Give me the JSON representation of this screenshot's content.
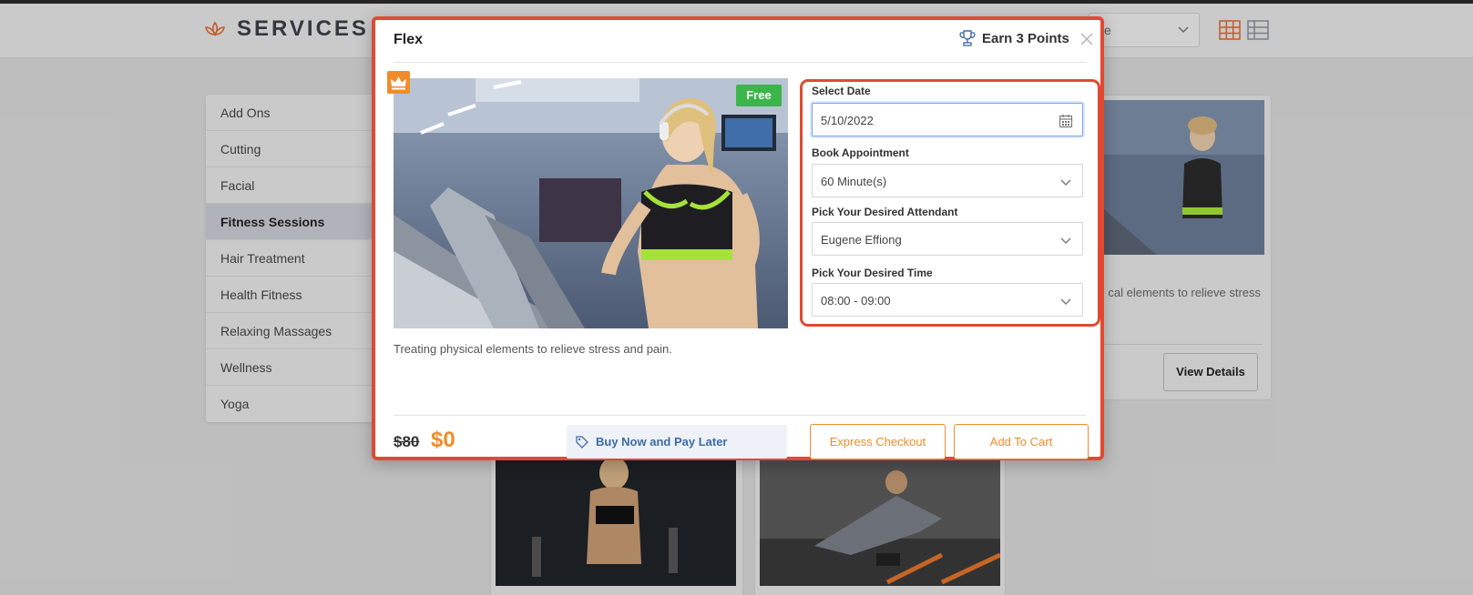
{
  "header": {
    "brand": "SERVICES",
    "select_value": "e"
  },
  "categories": [
    {
      "label": "Add Ons"
    },
    {
      "label": "Cutting"
    },
    {
      "label": "Facial"
    },
    {
      "label": "Fitness Sessions",
      "active": true
    },
    {
      "label": "Hair Treatment"
    },
    {
      "label": "Health Fitness"
    },
    {
      "label": "Relaxing Massages"
    },
    {
      "label": "Wellness"
    },
    {
      "label": "Yoga"
    }
  ],
  "background_card": {
    "text": "cal elements to relieve stress",
    "button": "View Details"
  },
  "modal": {
    "title": "Flex",
    "points": "Earn 3 Points",
    "badge": "Free",
    "description": "Treating physical elements to relieve stress and pain.",
    "form": {
      "date_label": "Select Date",
      "date_value": "5/10/2022",
      "appointment_label": "Book Appointment",
      "appointment_value": "60 Minute(s)",
      "attendant_label": "Pick Your Desired Attendant",
      "attendant_value": "Eugene Effiong",
      "time_label": "Pick Your Desired Time",
      "time_value": "08:00 - 09:00"
    },
    "price_old": "$80",
    "price_new": "$0",
    "bnpl": "Buy Now and Pay Later",
    "express_checkout": "Express Checkout",
    "add_to_cart": "Add To Cart"
  },
  "colors": {
    "accent": "#f08c2a",
    "highlight_border": "#e04a32",
    "free_badge": "#3cb54a",
    "bnpl_text": "#3d6aa8"
  }
}
